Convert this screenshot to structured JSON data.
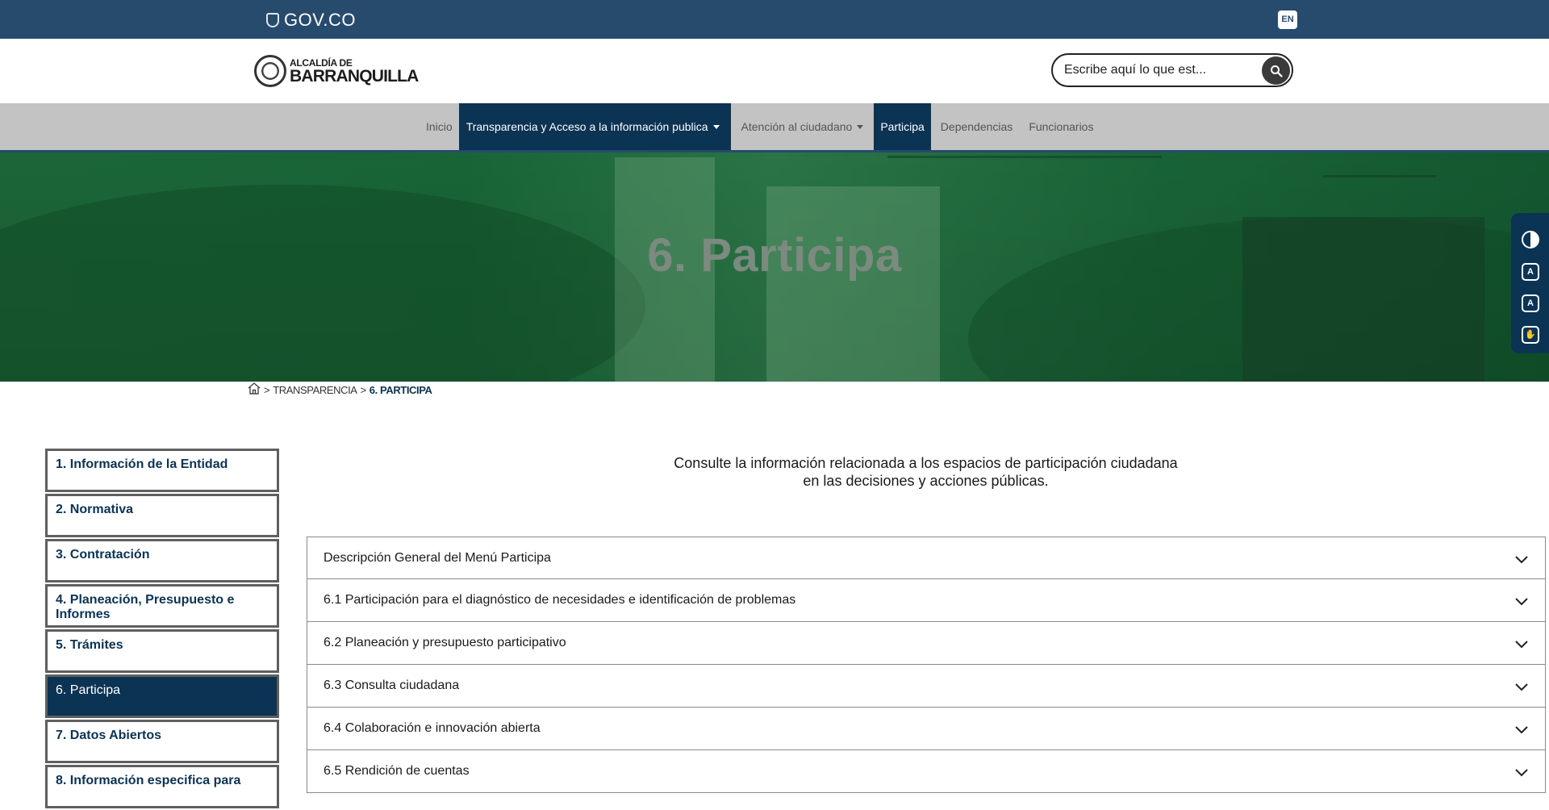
{
  "govbar": {
    "logo_text": "GOV.CO",
    "lang_label": "EN"
  },
  "brand": {
    "line1": "ALCALDÍA DE",
    "line2": "BARRANQUILLA"
  },
  "search": {
    "placeholder": "Escribe aquí lo que est..."
  },
  "nav": {
    "items": [
      {
        "label": "Inicio"
      },
      {
        "label": "Transparencia y Acceso a la información publica"
      },
      {
        "label": "Atención al ciudadano"
      },
      {
        "label": "Participa"
      },
      {
        "label": "Dependencias"
      },
      {
        "label": "Funcionarios"
      }
    ]
  },
  "hero": {
    "title": "6. Participa"
  },
  "breadcrumb": {
    "sep": ">",
    "level1": "TRANSPARENCIA",
    "current": "6. PARTICIPA"
  },
  "sidebar": {
    "items": [
      {
        "label": "1. Información de la Entidad"
      },
      {
        "label": "2. Normativa"
      },
      {
        "label": "3. Contratación"
      },
      {
        "label": "4. Planeación, Presupuesto e Informes"
      },
      {
        "label": "5. Trámites"
      },
      {
        "label": "6. Participa"
      },
      {
        "label": "7. Datos Abiertos"
      },
      {
        "label": "8. Información especifica para"
      }
    ]
  },
  "intro": {
    "line1": "Consulte la información relacionada a los espacios de participación ciudadana",
    "line2": "en las decisiones y acciones públicas."
  },
  "accordion": {
    "items": [
      {
        "label": "Descripción General del Menú Participa"
      },
      {
        "label": "6.1 Participación para el diagnóstico de necesidades e identificación de problemas"
      },
      {
        "label": "6.2 Planeación y presupuesto participativo"
      },
      {
        "label": "6.3 Consulta ciudadana"
      },
      {
        "label": "6.4 Colaboración e innovación abierta"
      },
      {
        "label": "6.5 Rendición de cuentas"
      }
    ]
  },
  "colors": {
    "gov_blue": "#274b6d",
    "navy": "#0b3354",
    "hero_green": "#1d6b3b",
    "nav_gray": "#c3c3c3"
  },
  "icons": [
    "shield-icon",
    "search-icon",
    "contrast-icon",
    "font-decrease-icon",
    "font-increase-icon",
    "sign-language-icon",
    "home-icon",
    "chevron-down-icon"
  ]
}
